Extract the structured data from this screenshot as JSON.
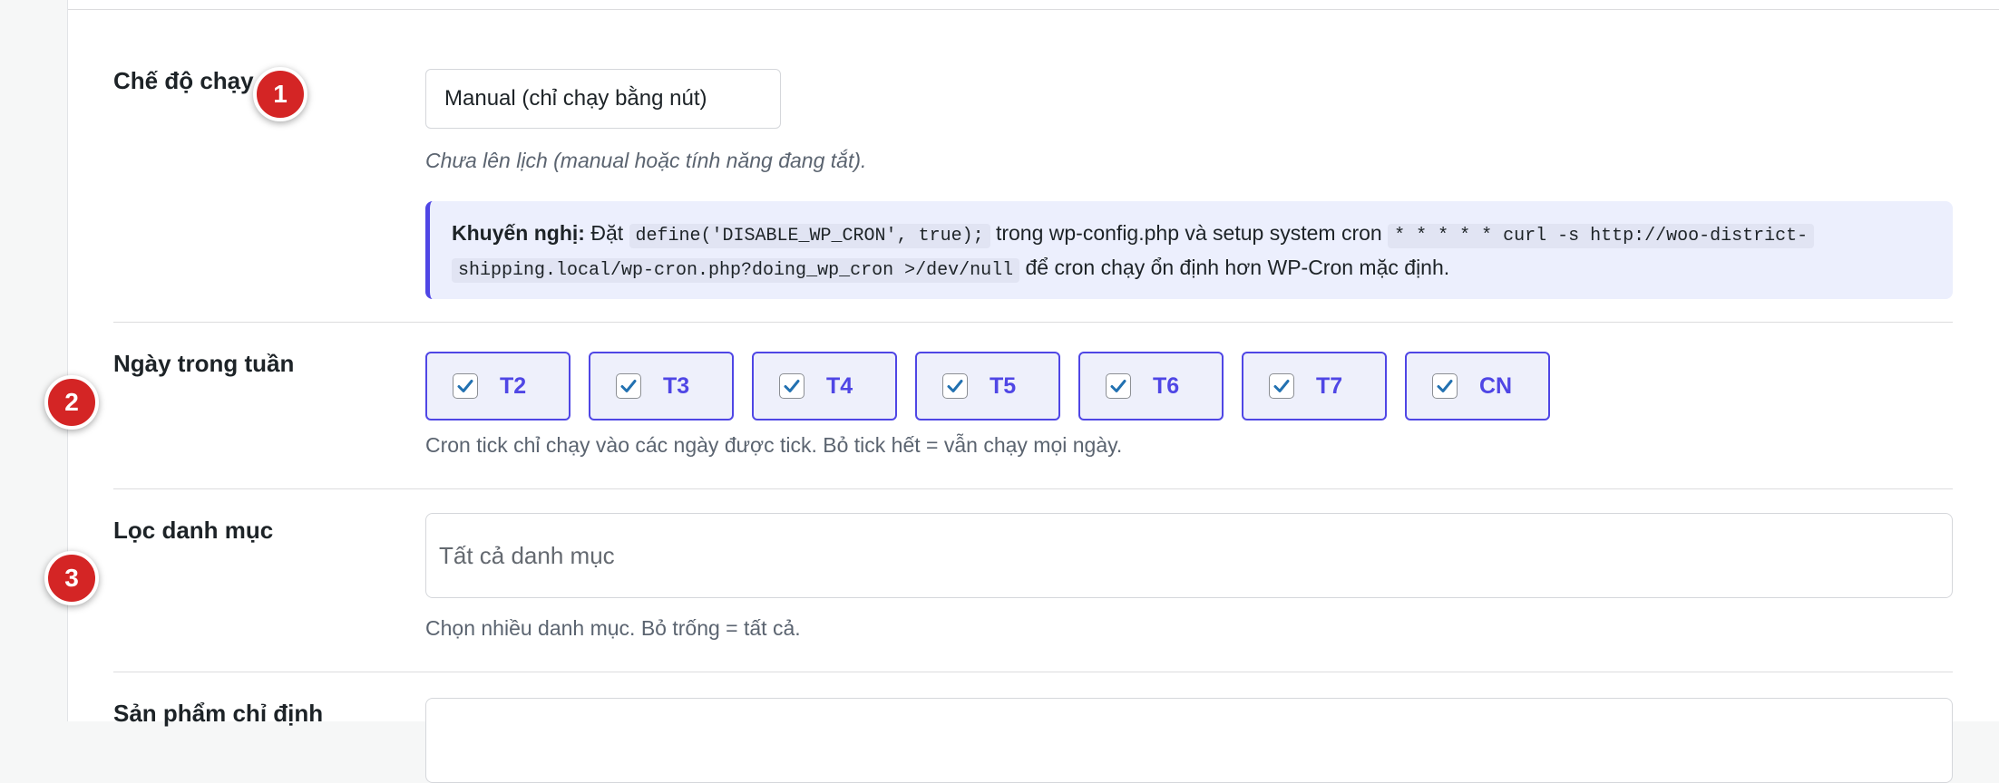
{
  "fields": {
    "run_mode": {
      "label": "Chế độ chạy",
      "badge": "1",
      "selected_value": "Manual (chỉ chạy bằng nút)",
      "description": "Chưa lên lịch (manual hoặc tính năng đang tắt)."
    },
    "notice": {
      "bold_label": "Khuyến nghị:",
      "text_before_code1": " Đặt ",
      "code1": "define('DISABLE_WP_CRON', true);",
      "text_between": " trong wp-config.php và setup system cron ",
      "code2_line1": "* * * * * curl -s http://woo-district-",
      "code2_line2": "shipping.local/wp-cron.php?doing_wp_cron >/dev/null",
      "text_after": " để cron chạy ổn định hơn WP-Cron mặc định."
    },
    "weekdays": {
      "label": "Ngày trong tuần",
      "badge": "2",
      "days": [
        {
          "label": "T2",
          "checked": true
        },
        {
          "label": "T3",
          "checked": true
        },
        {
          "label": "T4",
          "checked": true
        },
        {
          "label": "T5",
          "checked": true
        },
        {
          "label": "T6",
          "checked": true
        },
        {
          "label": "T7",
          "checked": true
        },
        {
          "label": "CN",
          "checked": true
        }
      ],
      "description": "Cron tick chỉ chạy vào các ngày được tick. Bỏ tick hết = vẫn chạy mọi ngày."
    },
    "category_filter": {
      "label": "Lọc danh mục",
      "badge": "3",
      "placeholder": "Tất cả danh mục",
      "description": "Chọn nhiều danh mục. Bỏ trống = tất cả."
    },
    "specific_products": {
      "label": "Sản phẩm chỉ định"
    }
  },
  "colors": {
    "accent": "#4f46e5",
    "badge": "#d42525",
    "check": "#2271b1"
  }
}
